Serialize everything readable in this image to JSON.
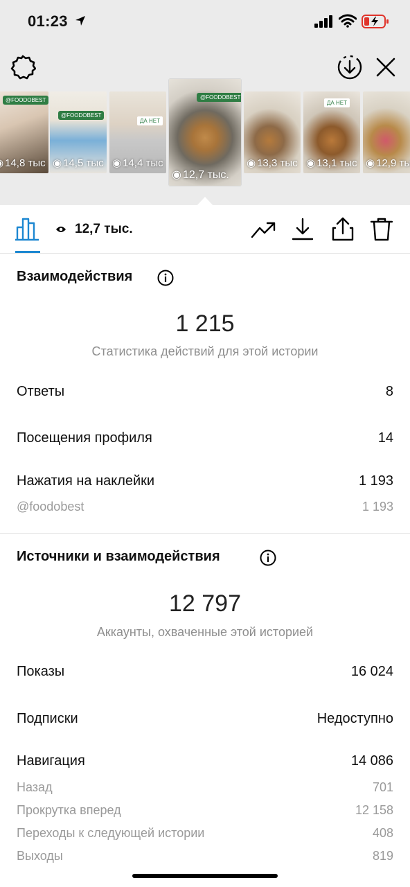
{
  "status_bar": {
    "time": "01:23",
    "icons": [
      "location-arrow-icon",
      "signal-icon",
      "wifi-icon",
      "battery-low-icon"
    ]
  },
  "header": {
    "icons": [
      "settings-icon",
      "save-story-icon",
      "close-icon"
    ]
  },
  "stories": [
    {
      "views": "14,8 тыс",
      "text": "@FOODOBEST"
    },
    {
      "views": "14,5 тыс",
      "text": "@FOODOBEST"
    },
    {
      "views": "14,4 тыс",
      "text": "ДА  НЕТ"
    },
    {
      "views": "12,7 тыс.",
      "text": "@FOODOBEST",
      "selected": true
    },
    {
      "views": "13,3 тыс",
      "text": ""
    },
    {
      "views": "13,1 тыс",
      "text": "ДА  НЕТ"
    },
    {
      "views": "12,9 тыс",
      "text": ""
    }
  ],
  "toolbar": {
    "views": "12,7 тыс.",
    "icons": [
      "insights-tab-icon",
      "eye-icon",
      "trend-icon",
      "download-icon",
      "share-icon",
      "trash-icon"
    ]
  },
  "interactions": {
    "title": "Взаимодействия",
    "total": "1 215",
    "caption": "Статистика действий для этой истории",
    "rows": [
      {
        "label": "Ответы",
        "value": "8"
      },
      {
        "label": "Посещения профиля",
        "value": "14"
      },
      {
        "label": "Нажатия на наклейки",
        "value": "1 193"
      }
    ],
    "sub_rows": [
      {
        "label": "@foodobest",
        "value": "1 193"
      }
    ]
  },
  "discovery": {
    "title": "Источники и взаимодействия",
    "total": "12 797",
    "caption": "Аккаунты, охваченные этой историей",
    "rows": [
      {
        "label": "Показы",
        "value": "16 024"
      },
      {
        "label": "Подписки",
        "value": "Недоступно"
      },
      {
        "label": "Навигация",
        "value": "14 086"
      }
    ],
    "sub_rows": [
      {
        "label": "Назад",
        "value": "701"
      },
      {
        "label": "Прокрутка вперед",
        "value": "12 158"
      },
      {
        "label": "Переходы к следующей истории",
        "value": "408"
      },
      {
        "label": "Выходы",
        "value": "819"
      }
    ]
  },
  "colors": {
    "accent": "#1c87d1",
    "muted": "#8e8e8e",
    "battery_red": "#e0342b"
  }
}
